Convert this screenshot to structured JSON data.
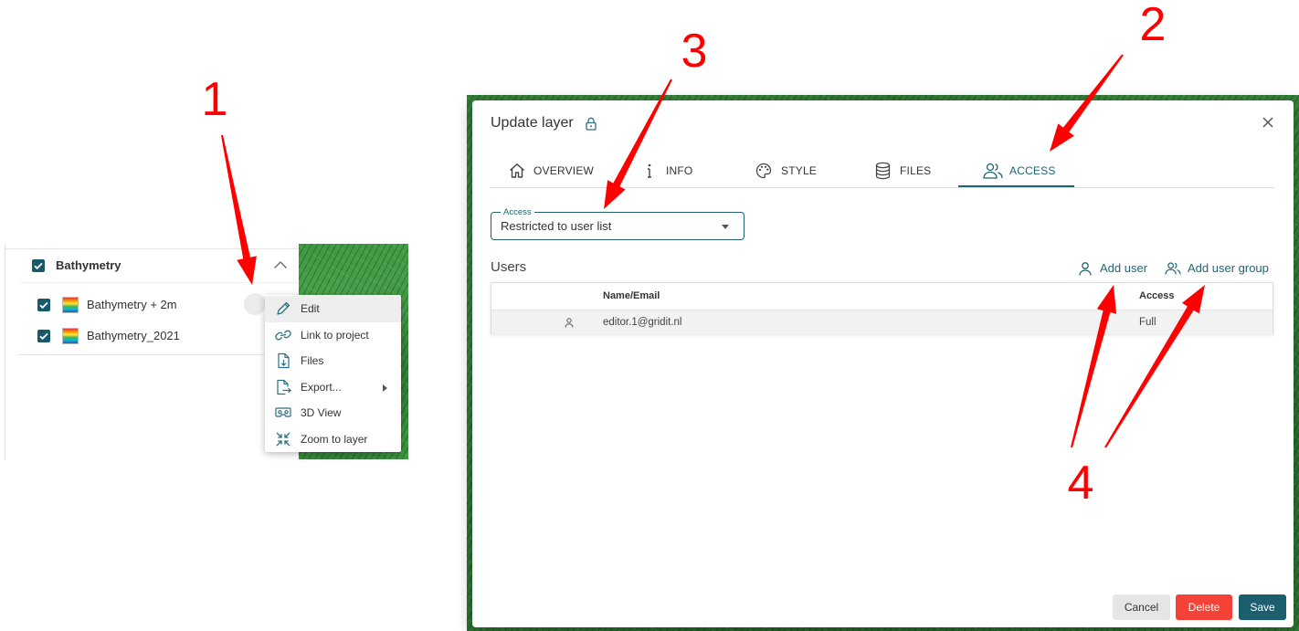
{
  "layer_panel": {
    "group": {
      "label": "Bathymetry",
      "checked": true,
      "collapse_icon": "chevron-up-icon"
    },
    "layers": [
      {
        "label": "Bathymetry + 2m",
        "checked": true,
        "legend_icon": "rainbow-gradient-icon"
      },
      {
        "label": "Bathymetry_2021",
        "checked": true,
        "legend_icon": "rainbow-gradient-icon"
      }
    ]
  },
  "context_menu": {
    "items": [
      {
        "label": "Edit",
        "icon": "pencil-icon",
        "highlighted": true
      },
      {
        "label": "Link to project",
        "icon": "link-icon"
      },
      {
        "label": "Files",
        "icon": "file-download-icon"
      },
      {
        "label": "Export...",
        "icon": "file-export-icon",
        "has_submenu": true
      },
      {
        "label": "3D View",
        "icon": "vr-goggles-icon"
      },
      {
        "label": "Zoom to layer",
        "icon": "zoom-to-layer-icon"
      }
    ]
  },
  "dialog": {
    "title": "Update layer",
    "title_icon": "lock-icon",
    "close_icon": "close-icon",
    "tabs": [
      {
        "label": "OVERVIEW",
        "icon": "home-icon"
      },
      {
        "label": "INFO",
        "icon": "info-icon"
      },
      {
        "label": "STYLE",
        "icon": "palette-icon"
      },
      {
        "label": "FILES",
        "icon": "database-icon"
      },
      {
        "label": "ACCESS",
        "icon": "users-icon",
        "active": true
      }
    ],
    "access_select": {
      "label": "Access",
      "value": "Restricted to user list"
    },
    "users": {
      "heading": "Users",
      "add_user": "Add user",
      "add_user_group": "Add user group",
      "columns": [
        "Name/Email",
        "Access"
      ],
      "rows": [
        {
          "icon": "person-icon",
          "name": "editor.1@gridit.nl",
          "access": "Full"
        }
      ]
    },
    "buttons": {
      "cancel": "Cancel",
      "delete": "Delete",
      "save": "Save"
    }
  },
  "annotations": {
    "labels": [
      "1",
      "2",
      "3",
      "4"
    ],
    "color": "#ff0000"
  },
  "colors": {
    "accent": "#1b6373",
    "delete": "#f44336",
    "save": "#1b5e6e",
    "map_green": "#2f7834"
  }
}
